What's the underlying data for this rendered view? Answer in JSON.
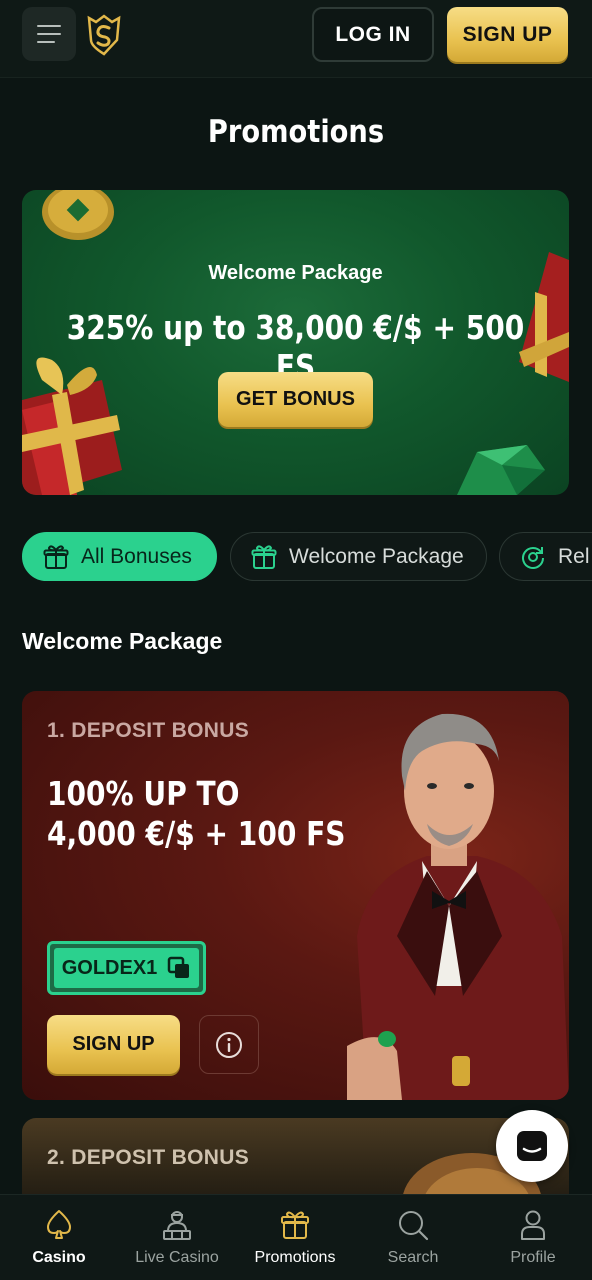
{
  "header": {
    "login_label": "LOG IN",
    "signup_label": "SIGN UP"
  },
  "page": {
    "title": "Promotions"
  },
  "hero": {
    "subtitle": "Welcome Package",
    "title": "325% up to 38,000 €/$ + 500 FS",
    "button_label": "GET BONUS"
  },
  "filters": [
    {
      "label": "All Bonuses",
      "icon": "gift-icon",
      "active": true
    },
    {
      "label": "Welcome Package",
      "icon": "gift-icon",
      "active": false
    },
    {
      "label": "Rel",
      "icon": "reload-icon",
      "active": false
    }
  ],
  "section": {
    "title": "Welcome Package"
  },
  "cards": [
    {
      "step": "1. DEPOSIT BONUS",
      "amount_line1": "100% UP TO",
      "amount_line2": "4,000 €/$ + 100 FS",
      "promo_code": "GOLDEX1",
      "button_label": "SIGN UP"
    },
    {
      "step": "2. DEPOSIT BONUS"
    }
  ],
  "bottom_nav": [
    {
      "label": "Casino",
      "icon": "spade-icon",
      "active": true
    },
    {
      "label": "Live Casino",
      "icon": "dealer-icon",
      "active": false
    },
    {
      "label": "Promotions",
      "icon": "gift-icon",
      "active": false
    },
    {
      "label": "Search",
      "icon": "search-icon",
      "active": false
    },
    {
      "label": "Profile",
      "icon": "user-icon",
      "active": false
    }
  ],
  "colors": {
    "background": "#0c1513",
    "accent_green": "#2bd18e",
    "gold": "#e9c250",
    "hero_green": "#11582c",
    "card_red": "#5a1812"
  }
}
